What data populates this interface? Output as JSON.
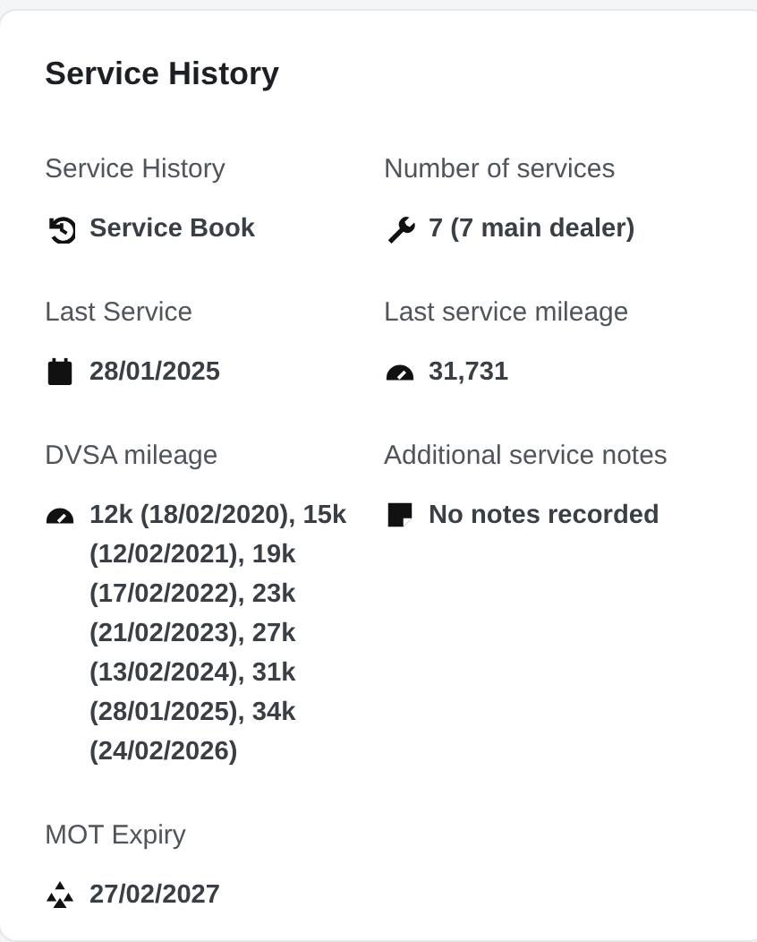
{
  "card": {
    "title": "Service History",
    "fields": [
      {
        "label": "Service History",
        "kind": "history",
        "value": "Service Book"
      },
      {
        "label": "Number of services",
        "kind": "wrench",
        "value": "7 (7 main dealer)"
      },
      {
        "label": "Last Service",
        "kind": "calendar",
        "value": "28/01/2025"
      },
      {
        "label": "Last service mileage",
        "kind": "gauge",
        "value": "31,731"
      },
      {
        "label": "DVSA mileage",
        "kind": "gauge",
        "value": "12k (18/02/2020), 15k (12/02/2021), 19k (17/02/2022), 23k (21/02/2023), 27k (13/02/2024), 31k (28/01/2025), 34k (24/02/2026)"
      },
      {
        "label": "Additional service notes",
        "kind": "note",
        "value": "No notes recorded"
      },
      {
        "label": "MOT Expiry",
        "kind": "mot",
        "value": "27/02/2027"
      }
    ]
  }
}
